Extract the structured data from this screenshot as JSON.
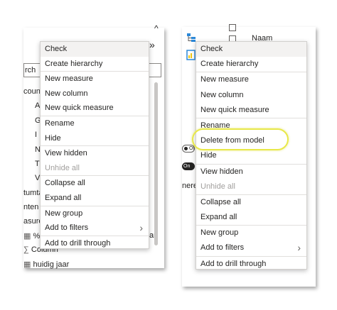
{
  "left_panel": {
    "search_fragment": "rch",
    "fragments": [
      "count",
      "A",
      "G",
      "I",
      "N",
      "T",
      "V",
      "tumta",
      "nten",
      "asure"
    ],
    "bottom_items": [
      {
        "icon": "calculator-icon",
        "label": "%"
      },
      {
        "icon": "sigma-icon",
        "label": "Column"
      },
      {
        "icon": "calculator-icon",
        "label": "huidig jaar"
      }
    ],
    "partial_right": "ar"
  },
  "right_panel": {
    "column_header": "Naam",
    "toggle_off_label": "Of",
    "toggle_on_label": "On",
    "fragments": [
      "nere"
    ]
  },
  "menu_left": {
    "items": [
      {
        "label": "Check"
      },
      {
        "label": "Create hierarchy"
      },
      {
        "sep": true
      },
      {
        "label": "New measure"
      },
      {
        "label": "New column"
      },
      {
        "label": "New quick measure"
      },
      {
        "sep": true
      },
      {
        "label": "Rename"
      },
      {
        "label": "Hide"
      },
      {
        "sep": true
      },
      {
        "label": "View hidden"
      },
      {
        "label": "Unhide all",
        "disabled": true
      },
      {
        "sep": true
      },
      {
        "label": "Collapse all"
      },
      {
        "label": "Expand all"
      },
      {
        "sep": true
      },
      {
        "label": "New group"
      },
      {
        "label": "Add to filters",
        "submenu": true
      },
      {
        "sep": true
      },
      {
        "label": "Add to drill through"
      }
    ]
  },
  "menu_right": {
    "items": [
      {
        "label": "Check"
      },
      {
        "label": "Create hierarchy"
      },
      {
        "sep": true
      },
      {
        "label": "New measure"
      },
      {
        "label": "New column"
      },
      {
        "label": "New quick measure"
      },
      {
        "sep": true
      },
      {
        "label": "Rename"
      },
      {
        "label": "Delete from model",
        "highlighted": true
      },
      {
        "label": "Hide"
      },
      {
        "sep": true
      },
      {
        "label": "View hidden"
      },
      {
        "label": "Unhide all",
        "disabled": true
      },
      {
        "sep": true
      },
      {
        "label": "Collapse all"
      },
      {
        "label": "Expand all"
      },
      {
        "sep": true
      },
      {
        "label": "New group"
      },
      {
        "label": "Add to filters",
        "submenu": true
      },
      {
        "sep": true
      },
      {
        "label": "Add to drill through"
      }
    ]
  },
  "icons": {
    "collapse": "chevron-up-icon",
    "expand_pane": "double-chevron-right-icon",
    "submenu": "chevron-right-icon"
  },
  "colors": {
    "highlight_ring": "#e8e84a",
    "disabled_text": "#a19f9d",
    "text": "#252423"
  }
}
